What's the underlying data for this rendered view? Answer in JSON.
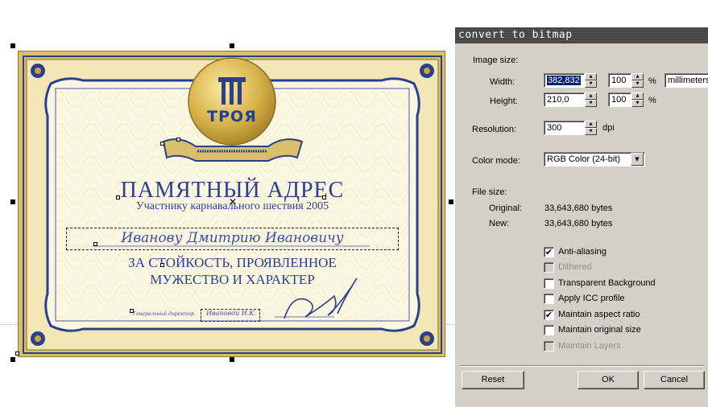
{
  "certificate": {
    "logo_text": "ТРОЯ",
    "title": "ПАМЯТНЫЙ АДРЕС",
    "subtitle": "Участнику карнавального шествия   2005",
    "recipient": "Иванову Дмитрию Ивановичу",
    "line1": "ЗА СТОЙКОСТЬ, ПРОЯВЛЕННОЕ",
    "line2": "МУЖЕСТВО И ХАРАКТЕР",
    "director_label": "Генеральный директор",
    "signer": "Ивановой И.К."
  },
  "dialog": {
    "title": "convert to bitmap",
    "image_size_label": "Image size:",
    "width_label": "Width:",
    "width_value": "382,832",
    "width_percent": "100",
    "height_label": "Height:",
    "height_value": "210,0",
    "height_percent": "100",
    "percent_sign": "%",
    "units": "millimeters",
    "resolution_label": "Resolution:",
    "resolution_value": "300",
    "dpi_label": "dpi",
    "color_mode_label": "Color mode:",
    "color_mode_value": "RGB Color (24-bit)",
    "file_size_label": "File size:",
    "original_label": "Original:",
    "original_value": "33,643,680 bytes",
    "new_label": "New:",
    "new_value": "33,643,680 bytes",
    "options": [
      {
        "label": "Anti-aliasing",
        "checked": true,
        "enabled": true
      },
      {
        "label": "Dithered",
        "checked": false,
        "enabled": false
      },
      {
        "label": "Transparent Background",
        "checked": false,
        "enabled": true
      },
      {
        "label": "Apply ICC profile",
        "checked": false,
        "enabled": true
      },
      {
        "label": "Maintain aspect ratio",
        "checked": true,
        "enabled": true
      },
      {
        "label": "Maintain original size",
        "checked": false,
        "enabled": true
      },
      {
        "label": "Maintain Layers",
        "checked": false,
        "enabled": false
      }
    ],
    "check_mark": "✔",
    "reset_label": "Reset",
    "ok_label": "OK",
    "cancel_label": "Cancel"
  },
  "colors": {
    "ink_blue": "#2c3f8c",
    "gold": "#c9a53c",
    "paper": "#fbf6e2",
    "dialog_face": "#d4d0c8"
  }
}
